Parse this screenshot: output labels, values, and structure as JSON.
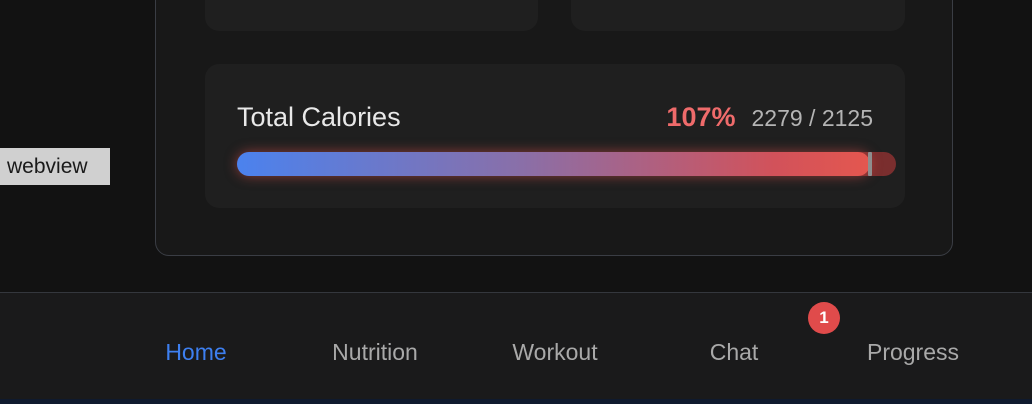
{
  "webview_label": "webview",
  "calories": {
    "title": "Total Calories",
    "percent_text": "107%",
    "ratio_text": "2279 / 2125",
    "consumed": 2279,
    "goal": 2125,
    "progress_fraction": 1.0
  },
  "nav": {
    "items": [
      {
        "label": "Home",
        "active": true
      },
      {
        "label": "Nutrition",
        "active": false
      },
      {
        "label": "Workout",
        "active": false
      },
      {
        "label": "Chat",
        "active": false
      },
      {
        "label": "Progress",
        "active": false
      }
    ],
    "badge": "1"
  },
  "colors": {
    "accent": "#3d7ff0",
    "over_goal": "#ef6b6b",
    "badge": "#e04b4b"
  }
}
